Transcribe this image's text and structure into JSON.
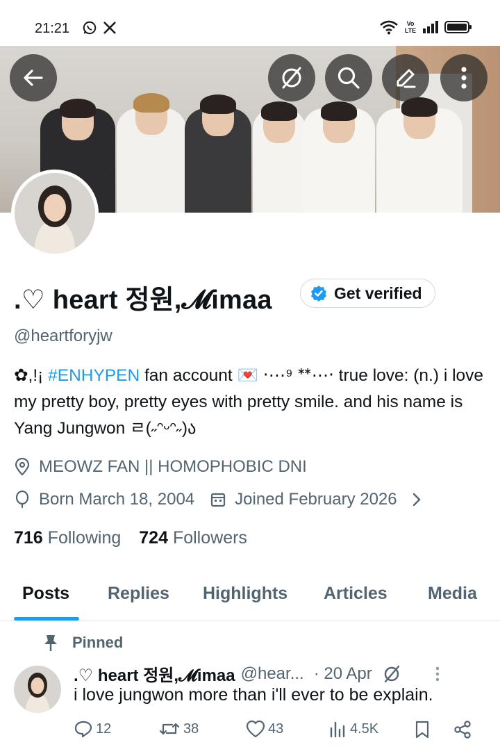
{
  "status_bar": {
    "time": "21:21",
    "left_icons": [
      "whatsapp-icon",
      "x-logo-icon"
    ],
    "right_icons": [
      "wifi-icon",
      "volte-icon",
      "signal-icon",
      "battery-icon"
    ],
    "network_label": "Vo LTE"
  },
  "header": {
    "back_icon": "arrow-left-icon",
    "action_icons": [
      "grok-icon",
      "search-icon",
      "edit-icon",
      "more-vertical-icon"
    ]
  },
  "profile": {
    "display_name": ".♡ heart 정원,𝓜imaa",
    "get_verified_label": "Get verified",
    "handle": "@heartforyjw",
    "bio_prefix": "✿,!¡ ",
    "bio_hashtag": "#ENHYPEN",
    "bio_rest": " fan account 💌 ‧⋯⁹ ᕯ⋯‧ true love: (n.) i love my pretty boy, pretty eyes with pretty smile. and his name is Yang Jungwon ㄹ(˶ᵔᵕᵔ˶)ა",
    "location": "MEOWZ FAN || HOMOPHOBIC DNI",
    "born": "Born March 18, 2004",
    "joined": "Joined February 2026",
    "following_count": "716",
    "following_label": "Following",
    "followers_count": "724",
    "followers_label": "Followers"
  },
  "tabs": [
    {
      "label": "Posts",
      "active": true
    },
    {
      "label": "Replies",
      "active": false
    },
    {
      "label": "Highlights",
      "active": false
    },
    {
      "label": "Articles",
      "active": false
    },
    {
      "label": "Media",
      "active": false
    }
  ],
  "pinned_post": {
    "pinned_label": "Pinned",
    "author_name": ".♡ heart 정원,𝓜imaa",
    "author_handle": "@hear...",
    "date": "· 20 Apr",
    "text": "i love jungwon more than i'll ever to be explain.",
    "replies": "12",
    "reposts": "38",
    "likes": "43",
    "views": "4.5K"
  },
  "colors": {
    "accent": "#1d9bf0",
    "text": "#0f1419",
    "secondary": "#536471"
  }
}
